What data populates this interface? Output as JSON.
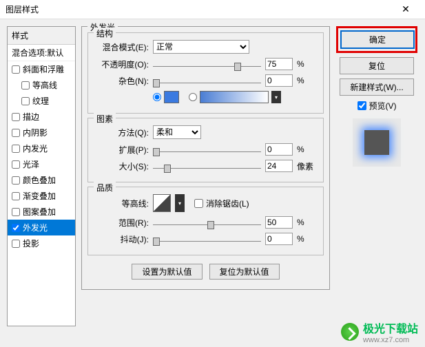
{
  "title": "图层样式",
  "left": {
    "header": "样式",
    "sub": "混合选项:默认",
    "items": [
      {
        "label": "斜面和浮雕",
        "checked": false,
        "indent": false
      },
      {
        "label": "等高线",
        "checked": false,
        "indent": true
      },
      {
        "label": "纹理",
        "checked": false,
        "indent": true
      },
      {
        "label": "描边",
        "checked": false,
        "indent": false
      },
      {
        "label": "内阴影",
        "checked": false,
        "indent": false
      },
      {
        "label": "内发光",
        "checked": false,
        "indent": false
      },
      {
        "label": "光泽",
        "checked": false,
        "indent": false
      },
      {
        "label": "颜色叠加",
        "checked": false,
        "indent": false
      },
      {
        "label": "渐变叠加",
        "checked": false,
        "indent": false
      },
      {
        "label": "图案叠加",
        "checked": false,
        "indent": false
      },
      {
        "label": "外发光",
        "checked": true,
        "indent": false,
        "selected": true
      },
      {
        "label": "投影",
        "checked": false,
        "indent": false
      }
    ]
  },
  "panel": {
    "title": "外发光",
    "structure": {
      "title": "结构",
      "blendMode": {
        "label": "混合模式(E):",
        "value": "正常"
      },
      "opacity": {
        "label": "不透明度(O):",
        "value": "75",
        "unit": "%"
      },
      "noise": {
        "label": "杂色(N):",
        "value": "0",
        "unit": "%"
      },
      "color": "#3b7ae0"
    },
    "elements": {
      "title": "图素",
      "technique": {
        "label": "方法(Q):",
        "value": "柔和"
      },
      "spread": {
        "label": "扩展(P):",
        "value": "0",
        "unit": "%"
      },
      "size": {
        "label": "大小(S):",
        "value": "24",
        "unit": "像素"
      }
    },
    "quality": {
      "title": "品质",
      "contour": {
        "label": "等高线:"
      },
      "antialias": {
        "label": "消除锯齿(L)",
        "checked": false
      },
      "range": {
        "label": "范围(R):",
        "value": "50",
        "unit": "%"
      },
      "jitter": {
        "label": "抖动(J):",
        "value": "0",
        "unit": "%"
      }
    },
    "setDefault": "设置为默认值",
    "resetDefault": "复位为默认值"
  },
  "right": {
    "ok": "确定",
    "reset": "复位",
    "newStyle": "新建样式(W)...",
    "preview": "预览(V)"
  },
  "footer": {
    "brand": "极光下载站",
    "url": "www.xz7.com"
  }
}
